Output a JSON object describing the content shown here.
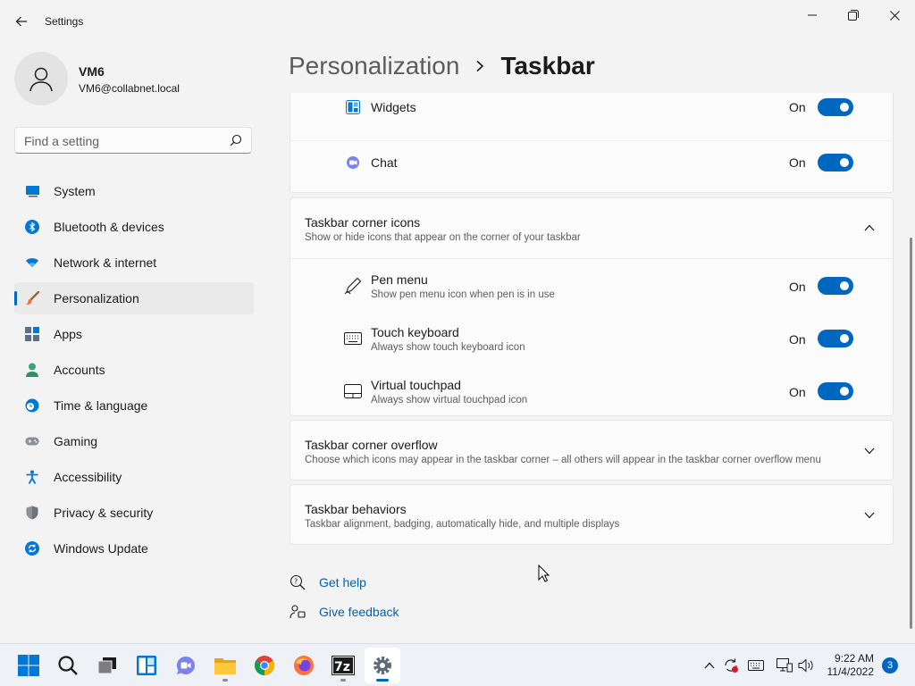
{
  "window": {
    "title": "Settings"
  },
  "profile": {
    "name": "VM6",
    "email": "VM6@collabnet.local"
  },
  "search": {
    "placeholder": "Find a setting"
  },
  "nav": {
    "items": [
      {
        "label": "System",
        "icon": "monitor-icon"
      },
      {
        "label": "Bluetooth & devices",
        "icon": "bluetooth-icon"
      },
      {
        "label": "Network & internet",
        "icon": "wifi-icon"
      },
      {
        "label": "Personalization",
        "icon": "brush-icon",
        "active": true
      },
      {
        "label": "Apps",
        "icon": "apps-icon"
      },
      {
        "label": "Accounts",
        "icon": "person-icon"
      },
      {
        "label": "Time & language",
        "icon": "clock-globe-icon"
      },
      {
        "label": "Gaming",
        "icon": "gamepad-icon"
      },
      {
        "label": "Accessibility",
        "icon": "accessibility-icon"
      },
      {
        "label": "Privacy & security",
        "icon": "shield-icon"
      },
      {
        "label": "Windows Update",
        "icon": "update-icon"
      }
    ]
  },
  "breadcrumb": {
    "parent": "Personalization",
    "current": "Taskbar"
  },
  "taskbar_items": {
    "widgets": {
      "label": "Widgets",
      "state": "On"
    },
    "chat": {
      "label": "Chat",
      "state": "On"
    }
  },
  "corner_icons": {
    "title": "Taskbar corner icons",
    "subtitle": "Show or hide icons that appear on the corner of your taskbar",
    "items": [
      {
        "title": "Pen menu",
        "subtitle": "Show pen menu icon when pen is in use",
        "state": "On"
      },
      {
        "title": "Touch keyboard",
        "subtitle": "Always show touch keyboard icon",
        "state": "On"
      },
      {
        "title": "Virtual touchpad",
        "subtitle": "Always show virtual touchpad icon",
        "state": "On"
      }
    ]
  },
  "corner_overflow": {
    "title": "Taskbar corner overflow",
    "subtitle": "Choose which icons may appear in the taskbar corner – all others will appear in the taskbar corner overflow menu"
  },
  "behaviors": {
    "title": "Taskbar behaviors",
    "subtitle": "Taskbar alignment, badging, automatically hide, and multiple displays"
  },
  "links": {
    "help": "Get help",
    "feedback": "Give feedback"
  },
  "clock": {
    "time": "9:22 AM",
    "date": "11/4/2022"
  },
  "notifications": {
    "count": "3"
  },
  "colors": {
    "accent": "#0067c0",
    "link": "#005fb8"
  }
}
